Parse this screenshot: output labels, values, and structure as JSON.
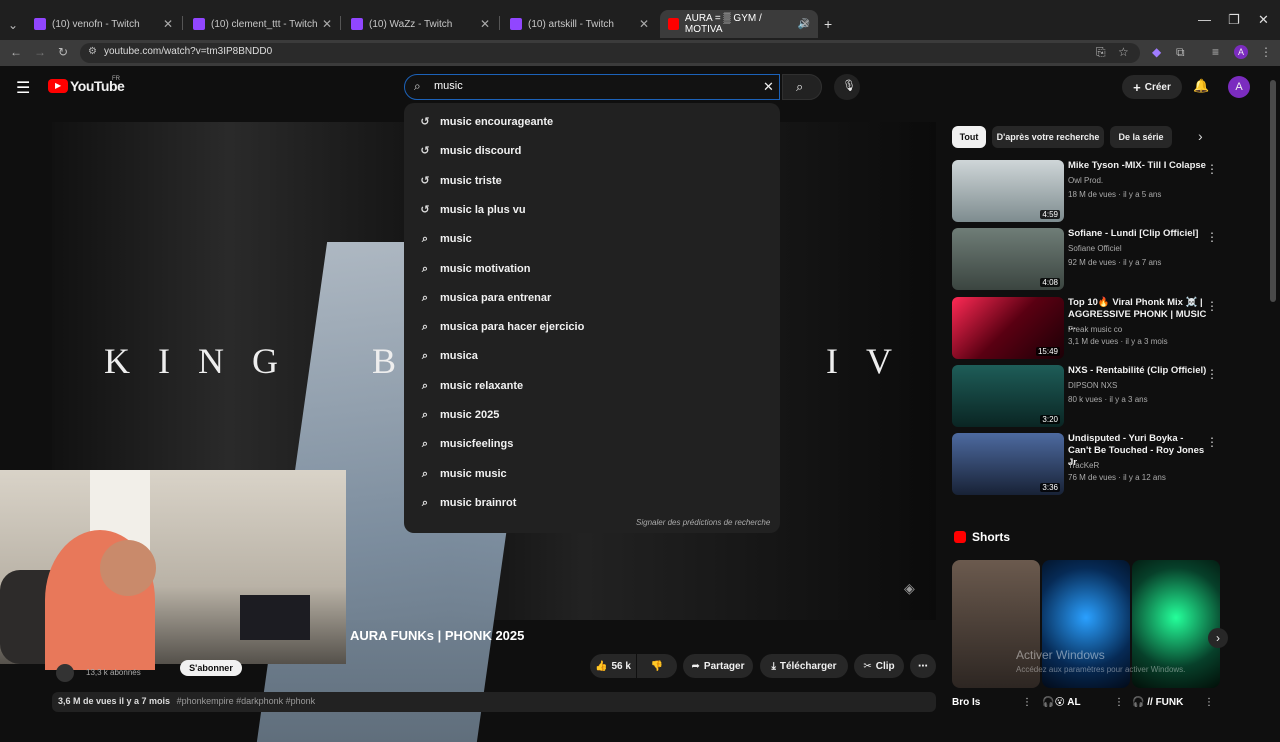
{
  "browser": {
    "tabs": [
      {
        "label": "(10) venofn - Twitch"
      },
      {
        "label": "(10) clement_ttt - Twitch"
      },
      {
        "label": "(10) WaZz - Twitch"
      },
      {
        "label": "(10) artskill - Twitch"
      },
      {
        "label": "AURA = ▒ GYM / MOTIVA"
      }
    ],
    "url": "youtube.com/watch?v=tm3IP8BNDD0"
  },
  "youtube": {
    "logo": "YouTube",
    "logo_region": "FR",
    "search_value": "music",
    "create_label": "Créer",
    "avatar_letter": "A"
  },
  "suggestions": [
    {
      "label": "music encourageante",
      "icon": "history-icon"
    },
    {
      "label": "music discourd",
      "icon": "history-icon"
    },
    {
      "label": "music triste",
      "icon": "history-icon"
    },
    {
      "label": "music la plus vu",
      "icon": "history-icon"
    },
    {
      "label": "music",
      "icon": "search-icon"
    },
    {
      "label": "music motivation",
      "icon": "search-icon"
    },
    {
      "label": "musica para entrenar",
      "icon": "search-icon"
    },
    {
      "label": "musica para hacer ejercicio",
      "icon": "search-icon"
    },
    {
      "label": "musica",
      "icon": "search-icon"
    },
    {
      "label": "music relaxante",
      "icon": "search-icon"
    },
    {
      "label": "music 2025",
      "icon": "search-icon"
    },
    {
      "label": "musicfeelings",
      "icon": "search-icon"
    },
    {
      "label": "music music",
      "icon": "search-icon"
    },
    {
      "label": "music brainrot",
      "icon": "search-icon"
    }
  ],
  "report_label": "Signaler des prédictions de recherche",
  "video": {
    "overlay_text_left": "KING",
    "overlay_text_mid": "B",
    "overlay_text_right": "IV",
    "title": "AURA FUNKs | PHONK 2025",
    "subscribers": "13,3 k abonnés",
    "subscribe_label": "S'abonner",
    "likes": "56 k",
    "share_label": "Partager",
    "download_label": "Télécharger",
    "clip_label": "Clip",
    "views_date": "3,6 M de vues  il y a 7 mois",
    "tags": "#phonkempire #darkphonk #phonk"
  },
  "chips": [
    "Tout",
    "D'après votre recherche",
    "De la série"
  ],
  "recommended": [
    {
      "title": "Mike Tyson -MIX- Till I Colapse",
      "channel": "Owl Prod.",
      "meta": "18 M de vues · il y a 5 ans",
      "duration": "4:59"
    },
    {
      "title": "Sofiane - Lundi [Clip Officiel]",
      "channel": "Sofiane Officiel",
      "meta": "92 M de vues · il y a 7 ans",
      "duration": "4:08"
    },
    {
      "title": "Top 10🔥 Viral Phonk Mix ☠️ | AGGRESSIVE PHONK | MUSIC ...",
      "channel": "Freak music co",
      "meta": "3,1 M de vues · il y a 3 mois",
      "duration": "15:49"
    },
    {
      "title": "NXS - Rentabilité (Clip Officiel)",
      "channel": "DIPSON NXS",
      "meta": "80 k vues · il y a 3 ans",
      "duration": "3:20"
    },
    {
      "title": "Undisputed - Yuri Boyka - Can't Be Touched - Roy Jones Jr",
      "channel": "TracKeR",
      "meta": "76 M de vues · il y a 12 ans",
      "duration": "3:36"
    }
  ],
  "shorts": {
    "heading": "Shorts",
    "items": [
      {
        "title": "Bro Is"
      },
      {
        "title": "🎧😮 AL"
      },
      {
        "title": "🎧 // FUNK"
      }
    ]
  },
  "watermark": {
    "line1": "Activer Windows",
    "line2": "Accédez aux paramètres pour activer Windows."
  },
  "colors": {
    "accent_red": "#ff0000",
    "search_border": "#1c62b9",
    "avatar": "#7b2cbf"
  }
}
